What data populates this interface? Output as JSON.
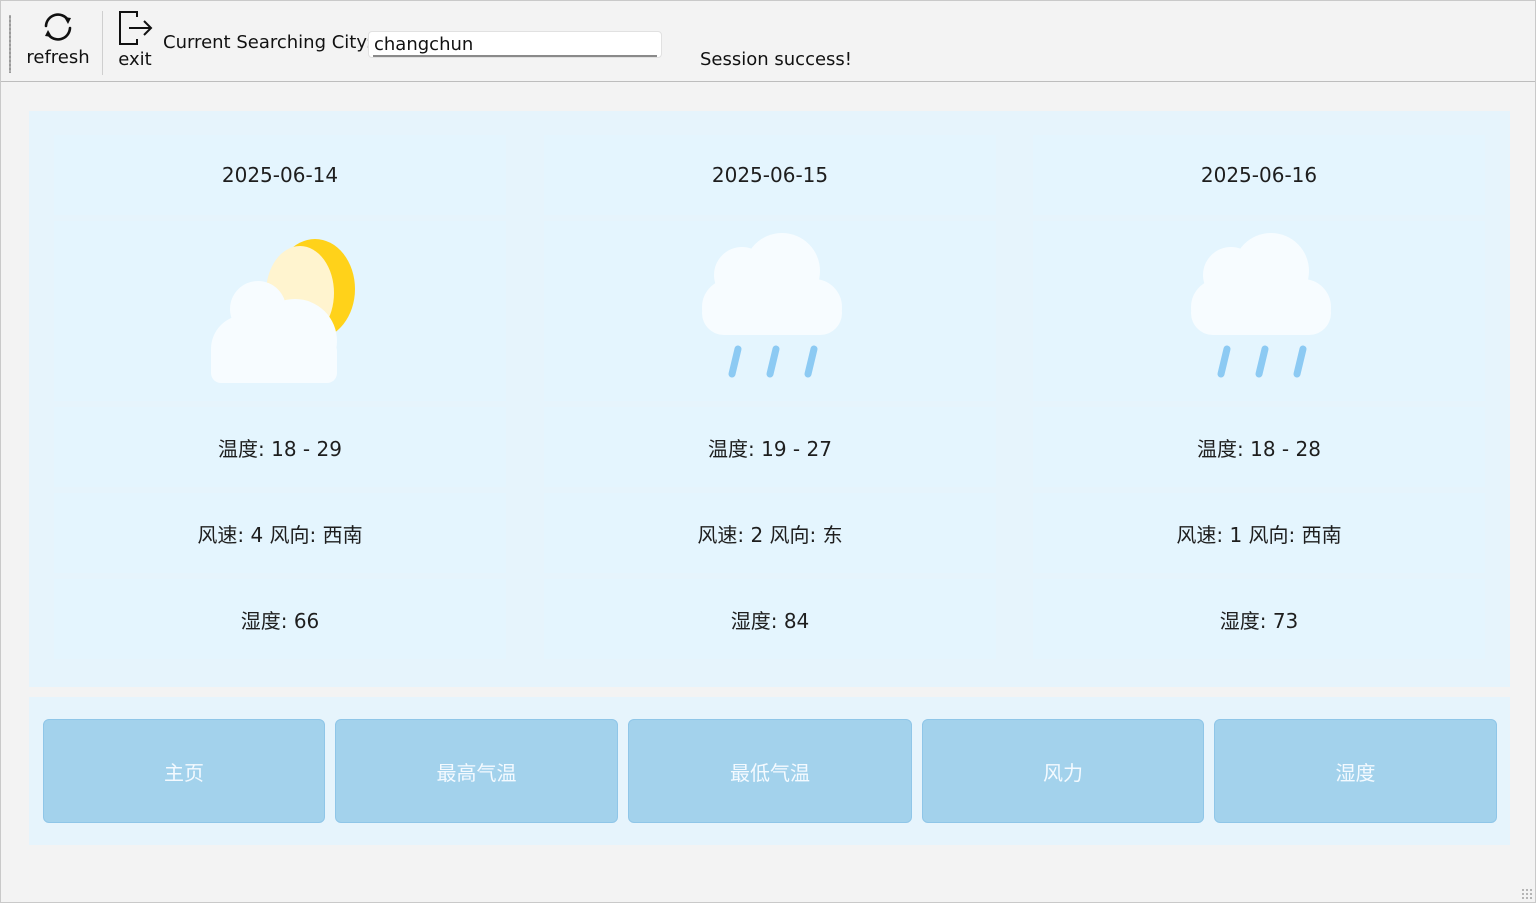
{
  "toolbar": {
    "refresh_label": "refresh",
    "exit_label": "exit",
    "city_label": "Current Searching City:",
    "city_value": "changchun",
    "status": "Session success!"
  },
  "forecast": [
    {
      "date": "2025-06-14",
      "icon": "partly-cloudy-icon",
      "temp": "温度: 18 - 29",
      "wind": "风速: 4 风向: 西南",
      "humidity": "湿度: 66"
    },
    {
      "date": "2025-06-15",
      "icon": "rain-icon",
      "temp": "温度: 19 - 27",
      "wind": "风速: 2 风向: 东",
      "humidity": "湿度: 84"
    },
    {
      "date": "2025-06-16",
      "icon": "rain-icon",
      "temp": "温度: 18 - 28",
      "wind": "风速: 1 风向: 西南",
      "humidity": "湿度: 73"
    }
  ],
  "nav": {
    "home": "主页",
    "max_temp": "最高气温",
    "min_temp": "最低气温",
    "wind": "风力",
    "humidity": "湿度"
  },
  "colors": {
    "panel_bg": "#e6f4fc",
    "cell_bg": "#e4f5fe",
    "nav_button": "#a3d2ec",
    "sun": "#ffd21a",
    "rain": "#8ccaf3"
  }
}
